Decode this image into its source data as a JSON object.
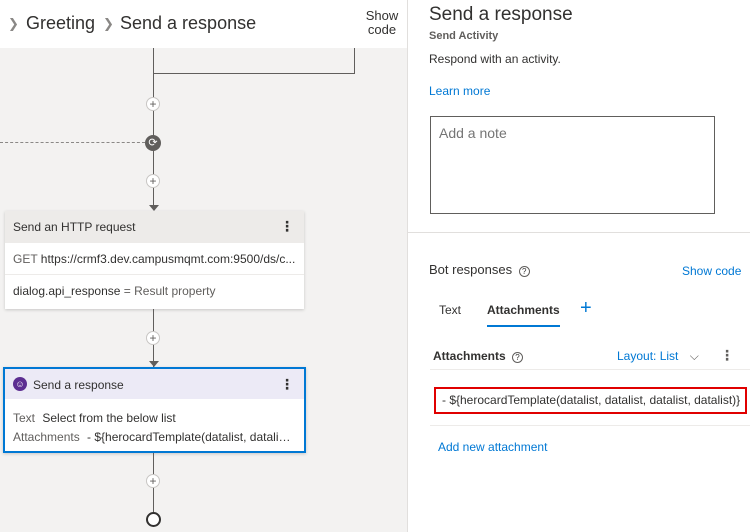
{
  "breadcrumb": {
    "items": [
      "Greeting",
      "Send a response"
    ]
  },
  "canvas": {
    "show_code_label": "Show code",
    "http_card": {
      "title": "Send an HTTP request",
      "method": "GET",
      "url": "https://crmf3.dev.campusmqmt.com:9500/ds/c...",
      "result_variable": "dialog.api_response",
      "result_suffix": "= Result property"
    },
    "response_card": {
      "title": "Send a response",
      "text_label": "Text",
      "text_value": "Select from the below list",
      "attachments_label": "Attachments",
      "attachments_value": "- ${herocardTemplate(datalist, datalist..."
    }
  },
  "panel": {
    "title": "Send a response",
    "subtitle": "Send Activity",
    "description": "Respond with an activity.",
    "learn_more": "Learn more",
    "note_placeholder": "Add a note",
    "bot_responses_label": "Bot responses",
    "show_code_link": "Show code",
    "tabs": [
      {
        "label": "Text",
        "active": false
      },
      {
        "label": "Attachments",
        "active": true
      }
    ],
    "attachments_header": "Attachments",
    "layout_label": "Layout: List",
    "attachment_item": "- ${herocardTemplate(datalist, datalist, datalist, datalist)}",
    "add_attachment": "Add new attachment"
  },
  "colors": {
    "accent": "#0078d4",
    "highlight_border": "#e00000",
    "bot_icon": "#5c2e91"
  }
}
